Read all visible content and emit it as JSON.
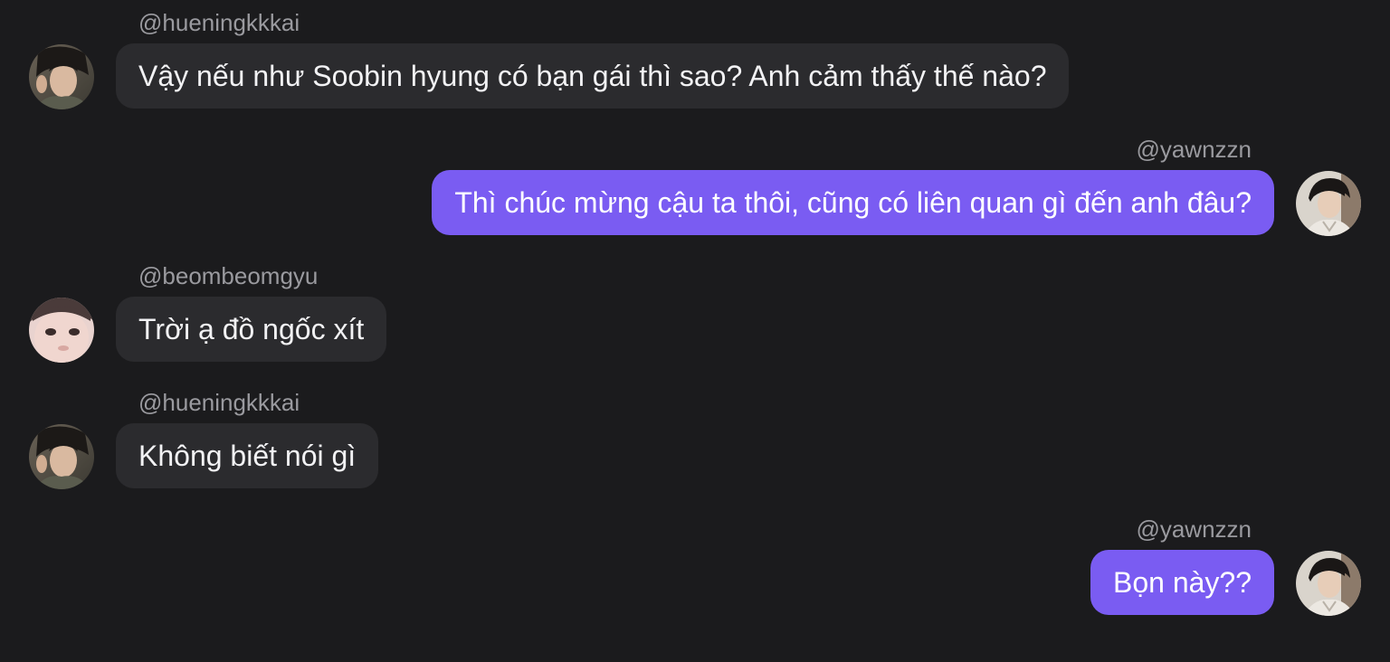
{
  "colors": {
    "background": "#1b1b1d",
    "incoming_bubble": "#2b2b2e",
    "outgoing_bubble": "#7a5cf2",
    "username_text": "#9a9a9f"
  },
  "messages": [
    {
      "direction": "incoming",
      "username": "@hueningkkkai",
      "text": "Vậy nếu như Soobin hyung có bạn gái thì sao? Anh cảm thấy thế nào?",
      "avatar": "avatar-hueningkkkai"
    },
    {
      "direction": "outgoing",
      "username": "@yawnzzn",
      "text": "Thì chúc mừng cậu ta thôi, cũng có liên quan gì đến anh đâu?",
      "avatar": "avatar-yawnzzn"
    },
    {
      "direction": "incoming",
      "username": "@beombeomgyu",
      "text": "Trời ạ đồ ngốc xít",
      "avatar": "avatar-beombeomgyu"
    },
    {
      "direction": "incoming",
      "username": "@hueningkkkai",
      "text": "Không biết nói gì",
      "avatar": "avatar-hueningkkkai"
    },
    {
      "direction": "outgoing",
      "username": "@yawnzzn",
      "text": "Bọn này??",
      "avatar": "avatar-yawnzzn"
    }
  ]
}
